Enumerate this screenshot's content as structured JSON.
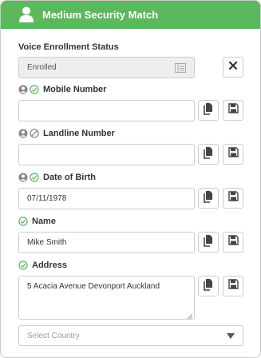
{
  "header": {
    "title": "Medium Security Match",
    "icon": "user-icon"
  },
  "colors": {
    "header_bg": "#5cb85c",
    "check_green": "#5cb85c",
    "neutral_gray": "#888888"
  },
  "voice": {
    "label": "Voice Enrollment Status",
    "value": "Enrolled",
    "clear_icon": "close-icon"
  },
  "mobile": {
    "label": "Mobile Number",
    "value": "",
    "status_icons": [
      "person-icon",
      "check-circle-icon"
    ]
  },
  "landline": {
    "label": "Landline Number",
    "value": "",
    "status_icons": [
      "person-icon",
      "blocked-circle-icon"
    ]
  },
  "dob": {
    "label": "Date of Birth",
    "value": "07/11/1978",
    "status_icons": [
      "person-icon",
      "check-circle-icon"
    ]
  },
  "name": {
    "label": "Name",
    "value": "Mike Smith",
    "status_icons": [
      "check-circle-icon"
    ]
  },
  "address": {
    "label": "Address",
    "value": "5 Acacia Avenue Devonport Auckland",
    "status_icons": [
      "check-circle-icon"
    ]
  },
  "country": {
    "placeholder": "Select Country"
  },
  "actions": {
    "copy_icon": "copy-icon",
    "save_icon": "save-icon"
  }
}
